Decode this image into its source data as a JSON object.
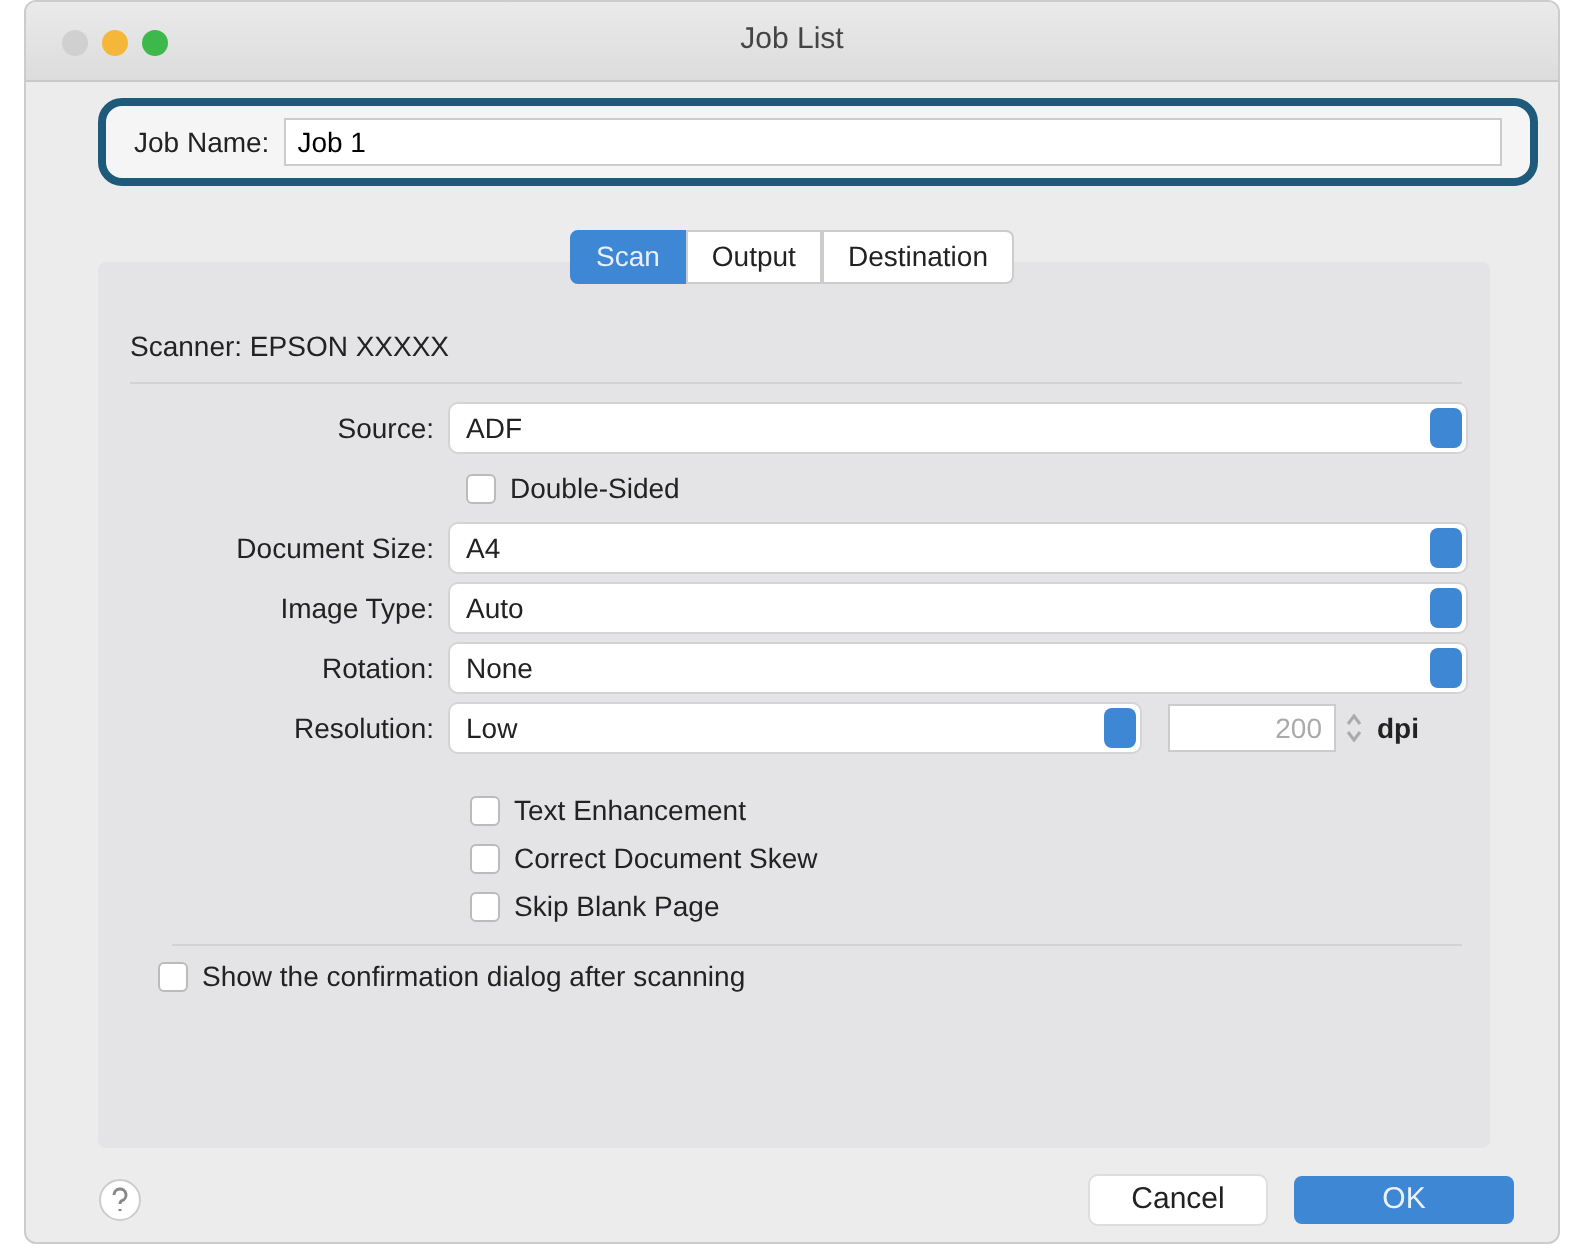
{
  "window": {
    "title": "Job List"
  },
  "job_name": {
    "label": "Job Name:",
    "value": "Job 1",
    "highlighted": true
  },
  "tabs": [
    {
      "label": "Scan",
      "selected": true
    },
    {
      "label": "Output",
      "selected": false
    },
    {
      "label": "Destination",
      "selected": false
    }
  ],
  "scanner": "Scanner: EPSON XXXXX",
  "settings": [
    {
      "kind": "select",
      "label": "Source:",
      "value": "ADF"
    },
    {
      "kind": "checkbox",
      "label": "Double-Sided",
      "checked": false
    },
    {
      "kind": "select",
      "label": "Document Size:",
      "value": "A4"
    },
    {
      "kind": "select",
      "label": "Image Type:",
      "value": "Auto"
    },
    {
      "kind": "select",
      "label": "Rotation:",
      "value": "None"
    },
    {
      "kind": "resolution",
      "label": "Resolution:",
      "value": "Low",
      "number": "200",
      "unit": "dpi"
    }
  ],
  "options": [
    {
      "label": "Text Enhancement",
      "checked": false
    },
    {
      "label": "Correct Document Skew",
      "checked": false
    },
    {
      "label": "Skip Blank Page",
      "checked": false
    }
  ],
  "confirm": {
    "label": "Show the confirmation dialog after scanning",
    "checked": false
  },
  "buttons": [
    {
      "label": "Cancel",
      "kind": "secondary"
    },
    {
      "label": "OK",
      "kind": "primary"
    }
  ]
}
